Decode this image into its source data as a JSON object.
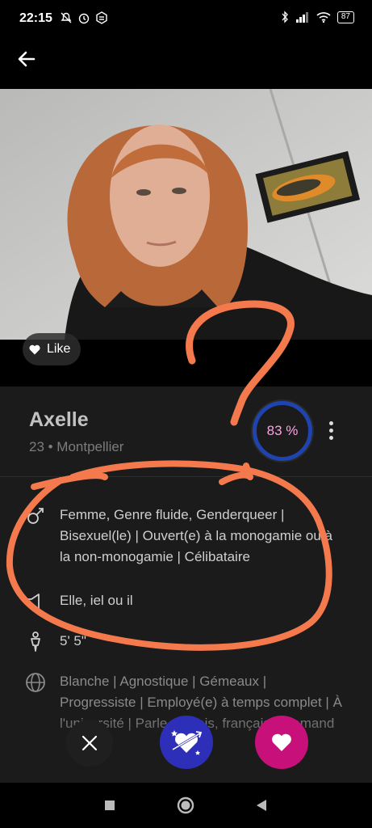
{
  "status_bar": {
    "time": "22:15",
    "battery": "87"
  },
  "profile": {
    "like_label": "Like",
    "name": "Axelle",
    "meta": "23 • Montpellier",
    "match_percent": "83 %",
    "details": [
      {
        "icon": "gender-icon",
        "text": "Femme, Genre fluide, Genderqueer | Bisexuel(le) | Ouvert(e) à la monogamie ou à la non-monogamie | Célibataire"
      },
      {
        "icon": "megaphone-icon",
        "text": "Elle, iel ou il"
      },
      {
        "icon": "person-height-icon",
        "text": "5' 5\""
      },
      {
        "icon": "globe-icon",
        "text": "Blanche | Agnostique | Gémeaux | Progressiste | Employé(e) à temps complet | À l'université | Parle anglais, français, Allemand"
      }
    ]
  },
  "colors": {
    "card_bg": "#1b1b1b",
    "match_ring": "#1f44b0",
    "match_text": "#ffa0e6",
    "superlike_bg": "#2e2fb8",
    "like_bg": "#c8107a",
    "annotation": "#f47a4e"
  }
}
